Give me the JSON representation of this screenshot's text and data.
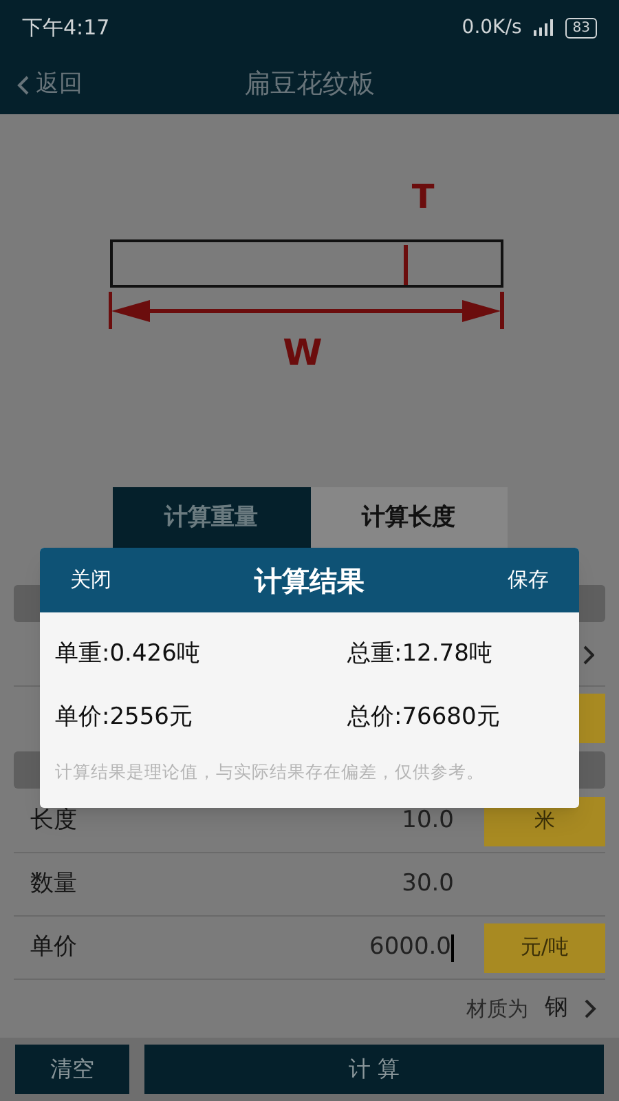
{
  "status_bar": {
    "time": "下午4:17",
    "speed": "0.0K/s",
    "battery": "83"
  },
  "header": {
    "back": "返回",
    "title": "扁豆花纹板"
  },
  "diagram": {
    "thickness_label": "T",
    "width_label": "W"
  },
  "tabs": [
    {
      "label": "计算重量",
      "selected": true
    },
    {
      "label": "计算长度",
      "selected": false
    }
  ],
  "hidden_rows": [
    {
      "kind": "section"
    },
    {
      "kind": "chevron"
    },
    {
      "kind": "unit"
    },
    {
      "kind": "section"
    }
  ],
  "fields": [
    {
      "label": "长度",
      "value": "10.0",
      "unit": "米",
      "focused": false
    },
    {
      "label": "数量",
      "value": "30.0",
      "focused": false
    },
    {
      "label": "单价",
      "value": "6000.0",
      "unit": "元/吨",
      "focused": true
    }
  ],
  "material": {
    "label": "材质为",
    "value": "钢"
  },
  "bottom": {
    "clear": "清空",
    "calculate": "计 算"
  },
  "dialog": {
    "close": "关闭",
    "title": "计算结果",
    "save": "保存",
    "results": [
      "单重:0.426吨",
      "总重:12.78吨",
      "单价:2556元",
      "总价:76680元"
    ],
    "note": "计算结果是理论值，与实际结果存在偏差，仅供参考。"
  }
}
